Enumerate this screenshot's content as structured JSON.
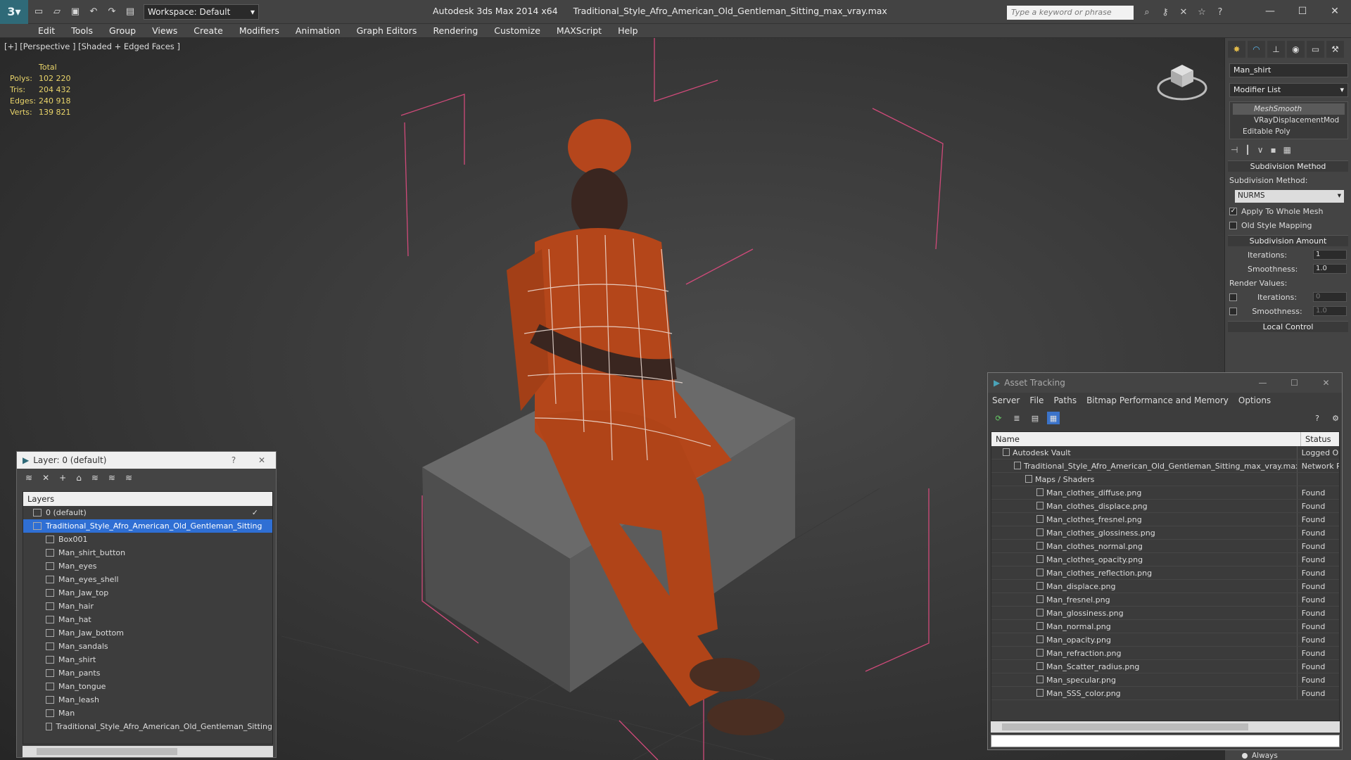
{
  "titlebar": {
    "workspace": "Workspace: Default",
    "app_title": "Autodesk 3ds Max  2014 x64",
    "file_title": "Traditional_Style_Afro_American_Old_Gentleman_Sitting_max_vray.max",
    "search_placeholder": "Type a keyword or phrase"
  },
  "menu": [
    "Edit",
    "Tools",
    "Group",
    "Views",
    "Create",
    "Modifiers",
    "Animation",
    "Graph Editors",
    "Rendering",
    "Customize",
    "MAXScript",
    "Help"
  ],
  "viewport": {
    "label": "[+] [Perspective ] [Shaded + Edged Faces ]",
    "stats_header": "Total",
    "stats": [
      {
        "k": "Polys:",
        "v": "102 220"
      },
      {
        "k": "Tris:",
        "v": "204 432"
      },
      {
        "k": "Edges:",
        "v": "240 918"
      },
      {
        "k": "Verts:",
        "v": "139 821"
      }
    ]
  },
  "command_panel": {
    "object_name": "Man_shirt",
    "modifier_list": "Modifier List",
    "stack": [
      "MeshSmooth",
      "VRayDisplacementMod",
      "Editable Poly"
    ],
    "subdiv_header": "Subdivision Method",
    "subdiv_label": "Subdivision Method:",
    "subdiv_value": "NURMS",
    "apply_whole": "Apply To Whole Mesh",
    "old_style": "Old Style Mapping",
    "amount_header": "Subdivision Amount",
    "iterations_label": "Iterations:",
    "iterations_value": "1",
    "smoothness_label": "Smoothness:",
    "smoothness_value": "1.0",
    "render_values": "Render Values:",
    "r_iterations_label": "Iterations:",
    "r_iterations_value": "0",
    "r_smoothness_label": "Smoothness:",
    "r_smoothness_value": "1.0",
    "local_header": "Local Control",
    "always": "Always"
  },
  "layer_window": {
    "title": "Layer: 0 (default)",
    "help": "?",
    "close": "✕",
    "header": "Layers",
    "rows": [
      "0 (default)",
      "Traditional_Style_Afro_American_Old_Gentleman_Sitting",
      "Box001",
      "Man_shirt_button",
      "Man_eyes",
      "Man_eyes_shell",
      "Man_Jaw_top",
      "Man_hair",
      "Man_hat",
      "Man_Jaw_bottom",
      "Man_sandals",
      "Man_shirt",
      "Man_pants",
      "Man_tongue",
      "Man_leash",
      "Man",
      "Traditional_Style_Afro_American_Old_Gentleman_Sitting"
    ]
  },
  "asset_window": {
    "title": "Asset Tracking",
    "menu": [
      "Server",
      "File",
      "Paths",
      "Bitmap Performance and Memory",
      "Options"
    ],
    "col_name": "Name",
    "col_status": "Status",
    "rows": [
      {
        "name": "Autodesk Vault",
        "status": "Logged Ou",
        "indent": 1
      },
      {
        "name": "Traditional_Style_Afro_American_Old_Gentleman_Sitting_max_vray.max",
        "status": "Network Pa",
        "indent": 2
      },
      {
        "name": "Maps / Shaders",
        "status": "",
        "indent": 3
      },
      {
        "name": "Man_clothes_diffuse.png",
        "status": "Found",
        "indent": 4
      },
      {
        "name": "Man_clothes_displace.png",
        "status": "Found",
        "indent": 4
      },
      {
        "name": "Man_clothes_fresnel.png",
        "status": "Found",
        "indent": 4
      },
      {
        "name": "Man_clothes_glossiness.png",
        "status": "Found",
        "indent": 4
      },
      {
        "name": "Man_clothes_normal.png",
        "status": "Found",
        "indent": 4
      },
      {
        "name": "Man_clothes_opacity.png",
        "status": "Found",
        "indent": 4
      },
      {
        "name": "Man_clothes_reflection.png",
        "status": "Found",
        "indent": 4
      },
      {
        "name": "Man_displace.png",
        "status": "Found",
        "indent": 4
      },
      {
        "name": "Man_fresnel.png",
        "status": "Found",
        "indent": 4
      },
      {
        "name": "Man_glossiness.png",
        "status": "Found",
        "indent": 4
      },
      {
        "name": "Man_normal.png",
        "status": "Found",
        "indent": 4
      },
      {
        "name": "Man_opacity.png",
        "status": "Found",
        "indent": 4
      },
      {
        "name": "Man_refraction.png",
        "status": "Found",
        "indent": 4
      },
      {
        "name": "Man_Scatter_radius.png",
        "status": "Found",
        "indent": 4
      },
      {
        "name": "Man_specular.png",
        "status": "Found",
        "indent": 4
      },
      {
        "name": "Man_SSS_color.png",
        "status": "Found",
        "indent": 4
      }
    ]
  }
}
